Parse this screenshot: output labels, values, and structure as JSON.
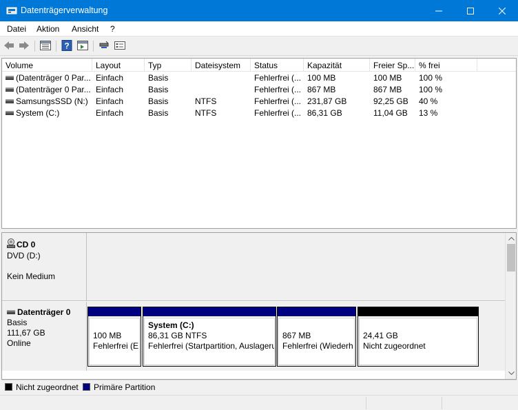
{
  "window": {
    "title": "Datenträgerverwaltung",
    "accent": "#0078d7"
  },
  "menu": [
    "Datei",
    "Aktion",
    "Ansicht",
    "?"
  ],
  "toolbar_icons": [
    "back-arrow-icon",
    "forward-arrow-icon",
    "list-view-icon",
    "help-icon",
    "properties-icon",
    "connect-icon",
    "settings-icon"
  ],
  "volumes": {
    "columns": [
      "Volume",
      "Layout",
      "Typ",
      "Dateisystem",
      "Status",
      "Kapazität",
      "Freier Sp...",
      "% frei"
    ],
    "rows": [
      [
        "(Datenträger 0 Par...",
        "Einfach",
        "Basis",
        "",
        "Fehlerfrei (...",
        "100 MB",
        "100 MB",
        "100 %"
      ],
      [
        "(Datenträger 0 Par...",
        "Einfach",
        "Basis",
        "",
        "Fehlerfrei (...",
        "867 MB",
        "867 MB",
        "100 %"
      ],
      [
        "SamsungsSSD (N:)",
        "Einfach",
        "Basis",
        "NTFS",
        "Fehlerfrei (...",
        "231,87 GB",
        "92,25 GB",
        "40 %"
      ],
      [
        "System (C:)",
        "Einfach",
        "Basis",
        "NTFS",
        "Fehlerfrei (...",
        "86,31 GB",
        "11,04 GB",
        "13 %"
      ]
    ]
  },
  "disks": {
    "cd0": {
      "name": "CD 0",
      "drive": "DVD (D:)",
      "media": "Kein Medium"
    },
    "disk0": {
      "name": "Datenträger 0",
      "type": "Basis",
      "size": "111,67 GB",
      "state": "Online",
      "partitions": [
        {
          "name": "",
          "size": "100 MB",
          "status": "Fehlerfrei (E",
          "color": "#000080"
        },
        {
          "name": "System  (C:)",
          "size": "86,31 GB NTFS",
          "status": "Fehlerfrei (Startpartition, Auslageru",
          "color": "#000080"
        },
        {
          "name": "",
          "size": "867 MB",
          "status": "Fehlerfrei (Wiederh",
          "color": "#000080"
        },
        {
          "name": "",
          "size": "24,41 GB",
          "status": "Nicht zugeordnet",
          "color": "#000000"
        }
      ]
    }
  },
  "legend": [
    {
      "label": "Nicht zugeordnet",
      "color": "#000000"
    },
    {
      "label": "Primäre Partition",
      "color": "#000080"
    }
  ]
}
